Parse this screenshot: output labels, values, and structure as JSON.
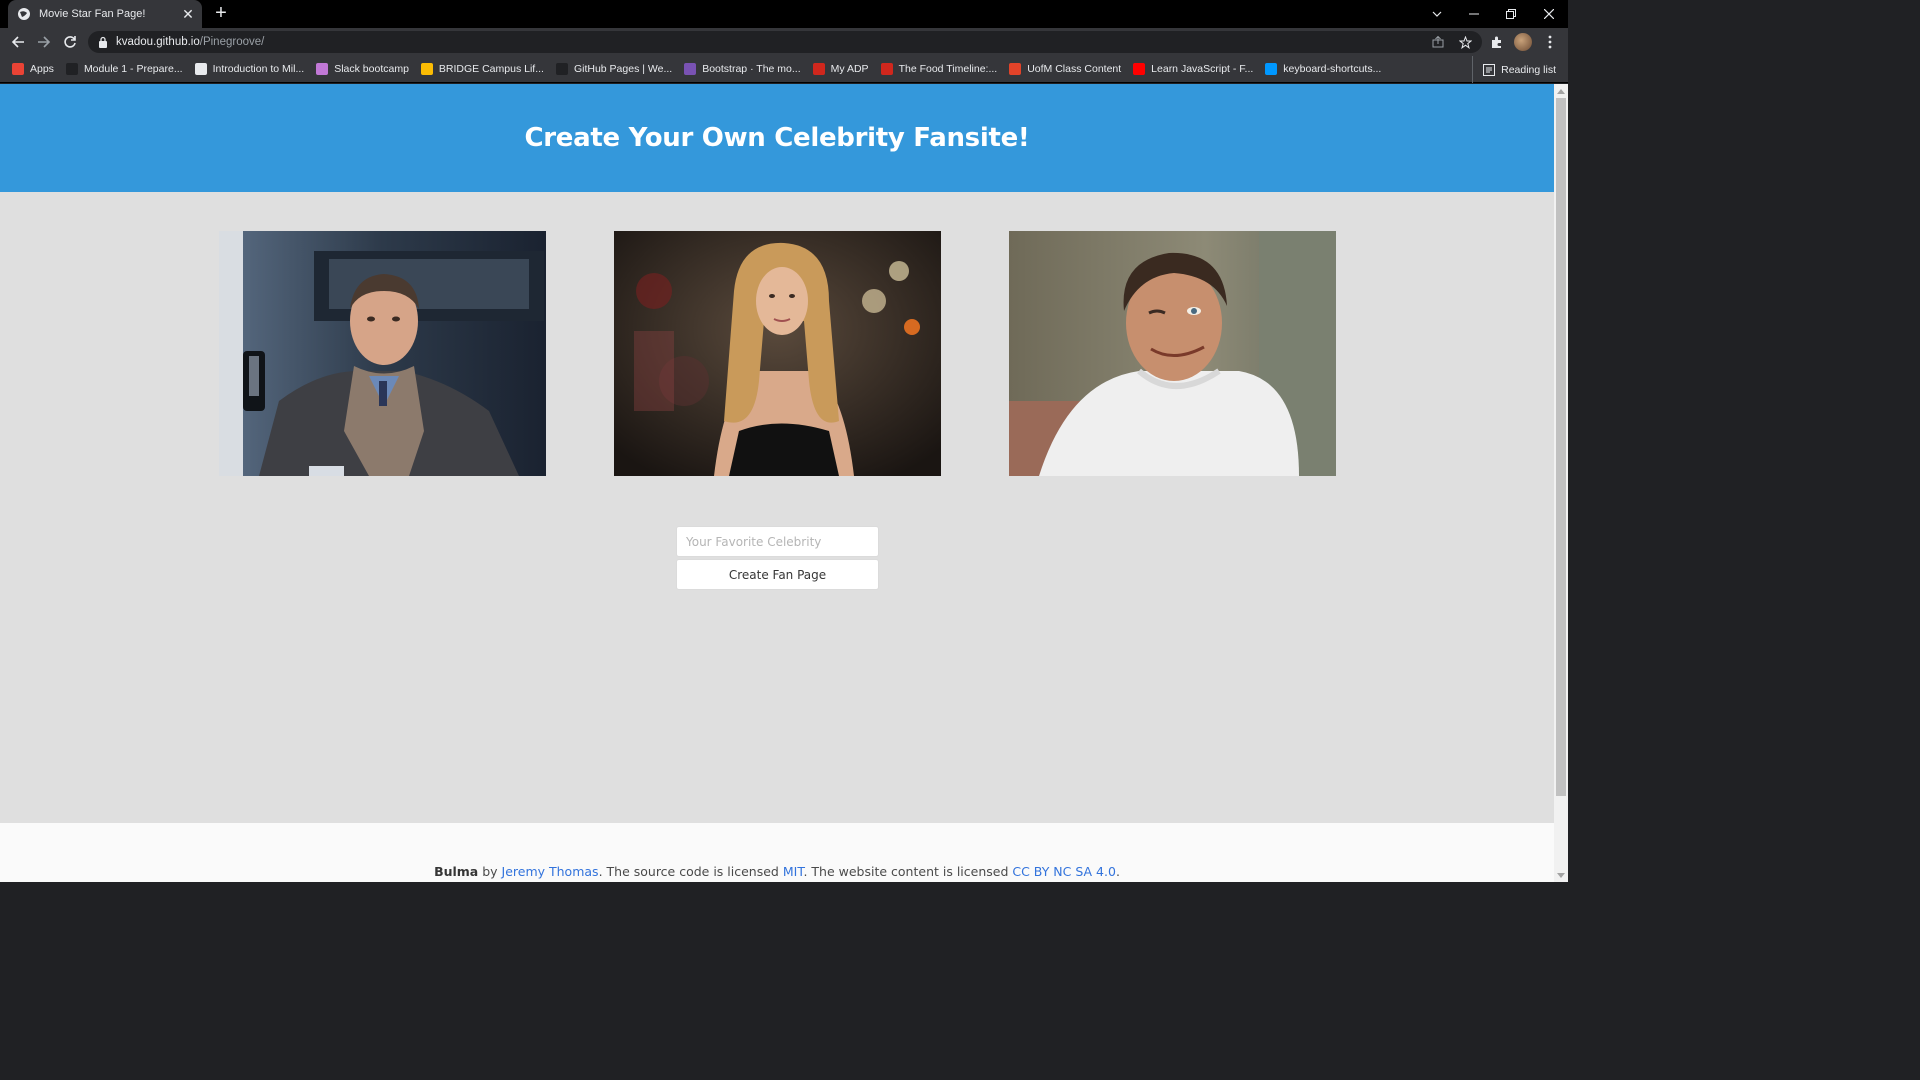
{
  "browser": {
    "tab_title": "Movie Star Fan Page!",
    "url_host": "kvadou.github.io",
    "url_path": "/Pinegroove/",
    "bookmarks": [
      {
        "label": "Apps",
        "color": "#ea4335"
      },
      {
        "label": "Module 1 - Prepare...",
        "color": "#202124"
      },
      {
        "label": "Introduction to Mil...",
        "color": "#e8eaed"
      },
      {
        "label": "Slack bootcamp",
        "color": "#c178d6"
      },
      {
        "label": "BRIDGE Campus Lif...",
        "color": "#fbbc04"
      },
      {
        "label": "GitHub Pages | We...",
        "color": "#202124"
      },
      {
        "label": "Bootstrap · The mo...",
        "color": "#7952b3"
      },
      {
        "label": "My ADP",
        "color": "#d0271d"
      },
      {
        "label": "The Food Timeline:...",
        "color": "#d0271d"
      },
      {
        "label": "UofM Class Content",
        "color": "#e24329"
      },
      {
        "label": "Learn JavaScript - F...",
        "color": "#ff0000"
      },
      {
        "label": "keyboard-shortcuts...",
        "color": "#0098ff"
      }
    ],
    "reading_list": "Reading list"
  },
  "page": {
    "hero_title": "Create Your Own Celebrity Fansite!",
    "input_placeholder": "Your Favorite Celebrity",
    "button_label": "Create Fan Page",
    "footer": {
      "brand": "Bulma",
      "by": " by ",
      "author": "Jeremy Thomas",
      "mid1": ". The source code is licensed ",
      "code_license": "MIT",
      "mid2": ". The website content is licensed ",
      "content_license": "CC BY NC SA 4.0",
      "end": "."
    }
  },
  "colors": {
    "hero": "#3498db",
    "background": "#dfdfdf",
    "link": "#3273dc"
  }
}
